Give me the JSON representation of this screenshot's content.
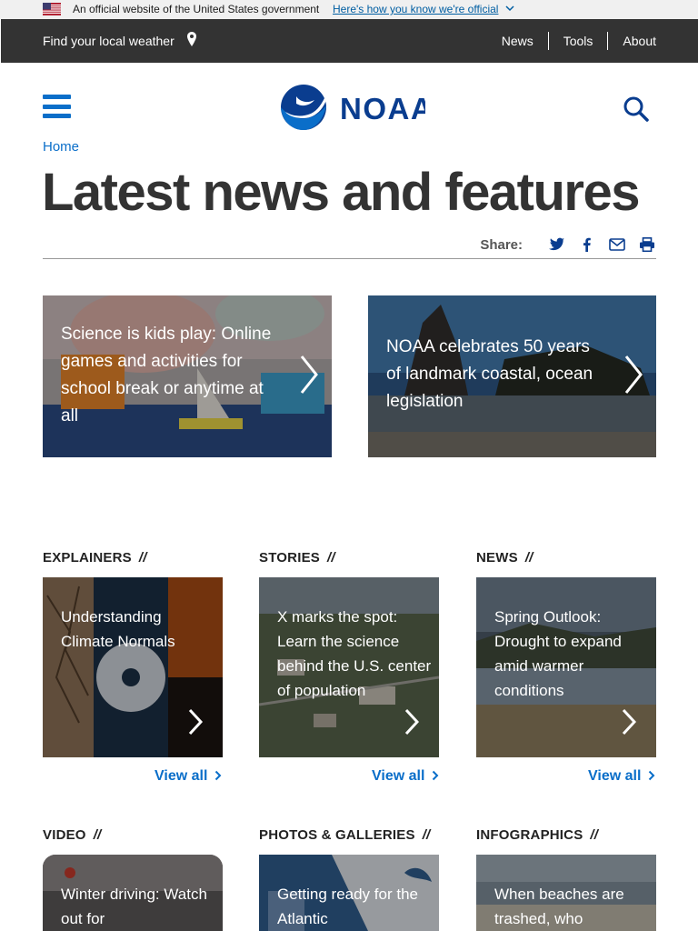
{
  "gov_banner": {
    "text": "An official website of the United States government",
    "link": "Here's how you know we're official"
  },
  "top_bar": {
    "find_weather": "Find your local weather",
    "nav": [
      "News",
      "Tools",
      "About"
    ]
  },
  "header": {
    "logo_text": "NOAA"
  },
  "breadcrumb": "Home",
  "page_title": "Latest news and features",
  "share": {
    "label": "Share:"
  },
  "featured": [
    {
      "title": "Science is kids play: Online games and activities for school break or anytime at all"
    },
    {
      "title": "NOAA celebrates 50 years of landmark coastal, ocean legislation"
    }
  ],
  "sections": [
    {
      "heading": "EXPLAINERS",
      "card_title": "Understanding Climate Normals",
      "view_all": "View all"
    },
    {
      "heading": "STORIES",
      "card_title": "X marks the spot: Learn the science behind the U.S. center of population",
      "view_all": "View all"
    },
    {
      "heading": "NEWS",
      "card_title": "Spring Outlook: Drought to expand amid warmer conditions",
      "view_all": "View all"
    },
    {
      "heading": "VIDEO",
      "card_title": "Winter driving: Watch out for"
    },
    {
      "heading": "PHOTOS & GALLERIES",
      "card_title": "Getting ready for the Atlantic"
    },
    {
      "heading": "INFOGRAPHICS",
      "card_title": "When beaches are trashed, who"
    }
  ],
  "separator": "//",
  "colors": {
    "link_blue": "#0a6ec9",
    "dark_bar": "#333333",
    "gov_banner_bg": "#f0f0f0"
  }
}
